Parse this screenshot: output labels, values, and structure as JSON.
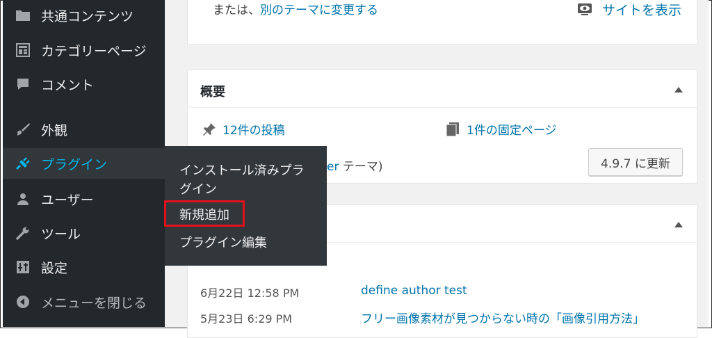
{
  "sidebar": {
    "items": [
      {
        "label": "共通コンテンツ",
        "icon": "folder-icon"
      },
      {
        "label": "カテゴリーページ",
        "icon": "layout-icon"
      },
      {
        "label": "コメント",
        "icon": "comment-icon"
      },
      {
        "label": "外観",
        "icon": "paintbrush-icon"
      },
      {
        "label": "プラグイン",
        "icon": "plugin-icon",
        "current": true
      },
      {
        "label": "ユーザー",
        "icon": "user-icon"
      },
      {
        "label": "ツール",
        "icon": "wrench-icon"
      },
      {
        "label": "設定",
        "icon": "settings-icon"
      },
      {
        "label": "メニューを閉じる",
        "icon": "collapse-icon"
      }
    ]
  },
  "flyout": {
    "items": [
      "インストール済みプラ",
      "グイン",
      "新規追加",
      "プラグイン編集"
    ],
    "highlighted": "新規追加"
  },
  "top_box": {
    "text_prefix": "または、",
    "link": "別のテーマに変更する",
    "view_site": "サイトを表示"
  },
  "overview": {
    "title": "概要",
    "posts_link": "12件の投稿",
    "pages_link": "1件の固定ページ",
    "theme_partial": "er",
    "theme_suffix": " テーマ)",
    "update_button": "4.9.7 に更新"
  },
  "activity": {
    "rows": [
      {
        "date": "6月22日 12:58 PM",
        "title": "define author test"
      },
      {
        "date": "5月23日 6:29 PM",
        "title": "フリー画像素材が見つからない時の「画像引用方法」"
      }
    ]
  },
  "colors": {
    "sidebar_bg": "#23282d",
    "accent": "#00b9eb",
    "link": "#0073aa",
    "highlight": "#e2101a"
  }
}
